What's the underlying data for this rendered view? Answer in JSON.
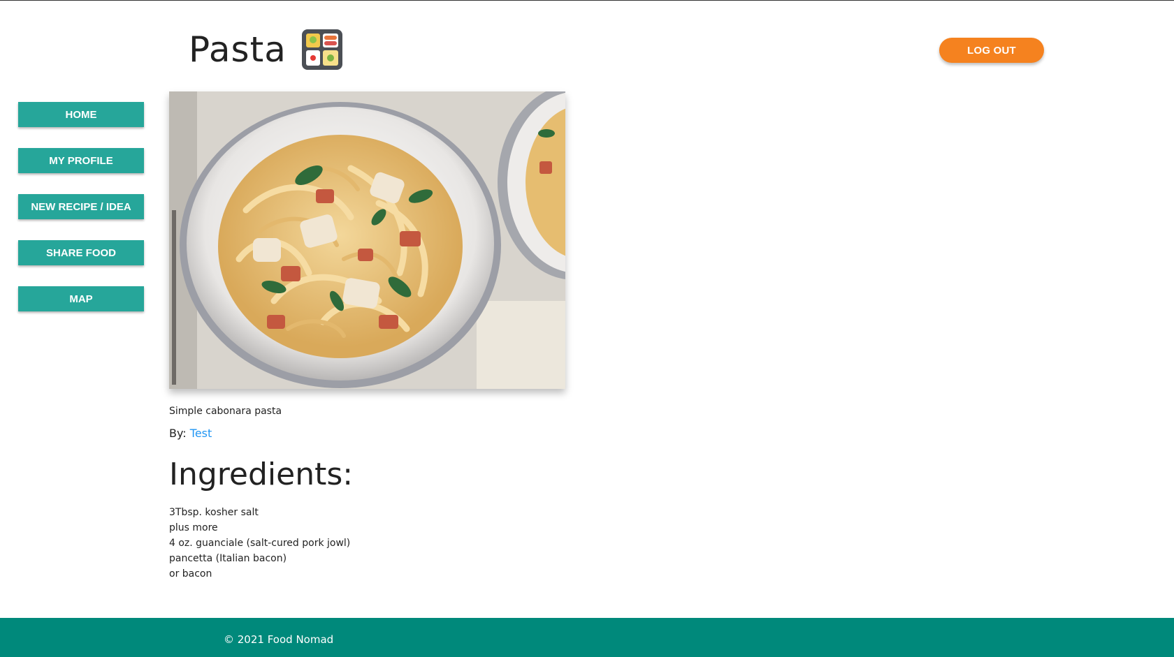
{
  "header": {
    "title": "Pasta",
    "title_icon": "bento-box-icon",
    "logout_label": "LOG OUT",
    "accent_color": "#f5821f"
  },
  "sidebar": {
    "color": "#26a69a",
    "items": [
      {
        "label": "HOME"
      },
      {
        "label": "MY PROFILE"
      },
      {
        "label": "NEW RECIPE / IDEA"
      },
      {
        "label": "SHARE FOOD"
      },
      {
        "label": "MAP"
      }
    ]
  },
  "recipe": {
    "caption": "Simple cabonara pasta",
    "by_label": "By:",
    "author": "Test",
    "ingredients_heading": "Ingredients:",
    "ingredients": [
      "3Tbsp. kosher salt",
      "plus more",
      "4 oz. guanciale (salt-cured pork jowl)",
      "pancetta (Italian bacon)",
      "or bacon"
    ]
  },
  "footer": {
    "text": "© 2021 Food Nomad",
    "color": "#00897b"
  }
}
